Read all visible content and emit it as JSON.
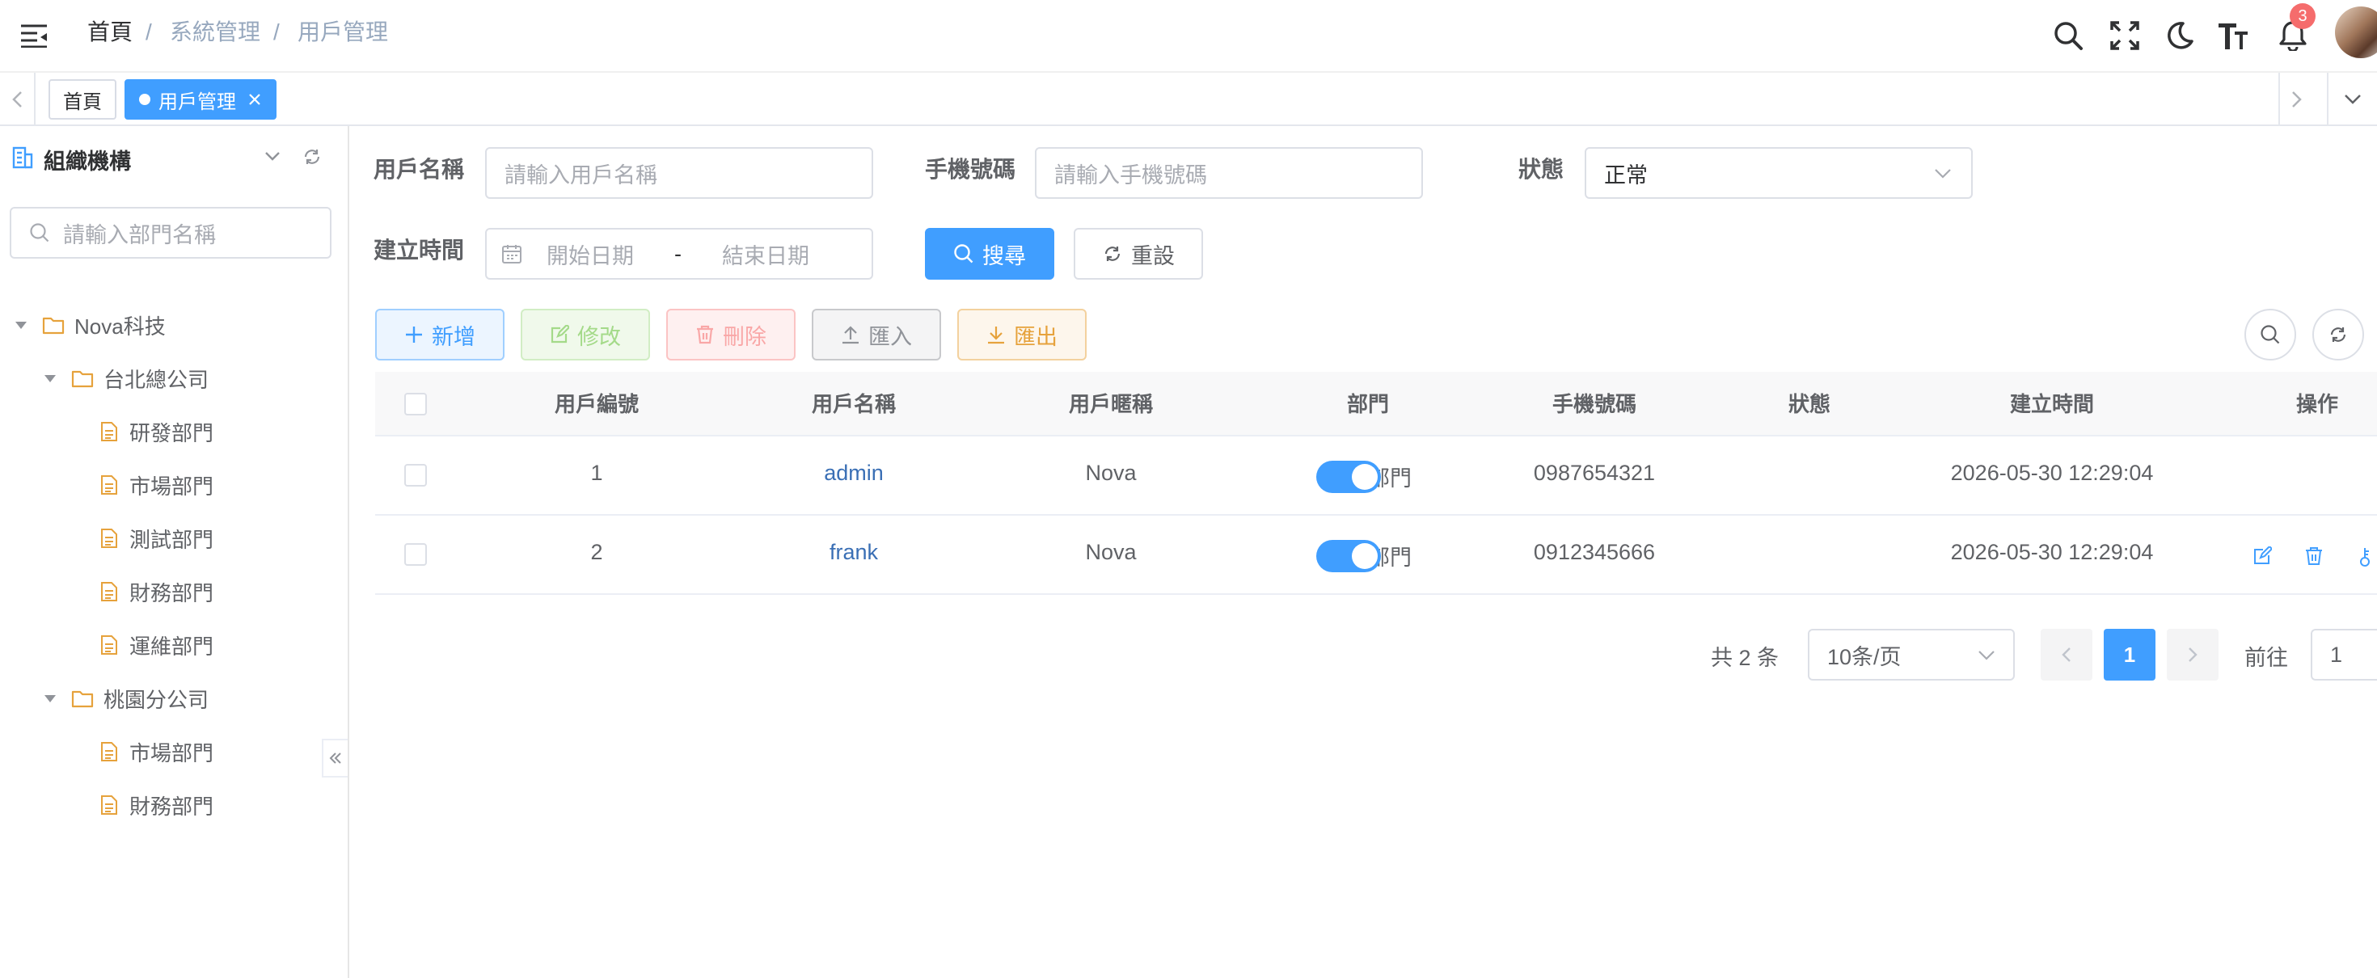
{
  "header": {
    "breadcrumb": [
      "首頁",
      "系統管理",
      "用戶管理"
    ],
    "separator": "/",
    "notification_count": "3"
  },
  "tabs": {
    "home": "首頁",
    "active": "用戶管理"
  },
  "sidebar": {
    "title": "組織機構",
    "search_placeholder": "請輸入部門名稱",
    "tree": {
      "root": "Nova科技",
      "branches": [
        {
          "label": "台北總公司",
          "children": [
            "研發部門",
            "市場部門",
            "測試部門",
            "財務部門",
            "運維部門"
          ]
        },
        {
          "label": "桃園分公司",
          "children": [
            "市場部門",
            "財務部門"
          ]
        }
      ]
    }
  },
  "filters": {
    "username_label": "用戶名稱",
    "username_placeholder": "請輸入用戶名稱",
    "phone_label": "手機號碼",
    "phone_placeholder": "請輸入手機號碼",
    "status_label": "狀態",
    "status_value": "正常",
    "created_label": "建立時間",
    "start_placeholder": "開始日期",
    "range_separator": "-",
    "end_placeholder": "結束日期",
    "search_button": "搜尋",
    "reset_button": "重設"
  },
  "toolbar": {
    "add": "新增",
    "edit": "修改",
    "delete": "刪除",
    "import": "匯入",
    "export": "匯出"
  },
  "table": {
    "columns": [
      "用戶編號",
      "用戶名稱",
      "用戶暱稱",
      "部門",
      "手機號碼",
      "狀態",
      "建立時間",
      "操作"
    ],
    "rows": [
      {
        "id": "1",
        "username": "admin",
        "nickname": "Nova",
        "dept": "研發部門",
        "phone": "0987654321",
        "status_on": true,
        "created": "2026-05-30 12:29:04"
      },
      {
        "id": "2",
        "username": "frank",
        "nickname": "Nova",
        "dept": "測試部門",
        "phone": "0912345666",
        "status_on": true,
        "created": "2026-05-30 12:29:04"
      }
    ]
  },
  "pagination": {
    "total": "共 2 条",
    "page_size": "10条/页",
    "current_page": "1",
    "goto_label": "前往",
    "goto_value": "1"
  },
  "colors": {
    "primary": "#409eff",
    "success": "#67c23a",
    "danger": "#f56c6c",
    "warning": "#e6a23c",
    "link": "#3a6fb5",
    "badge": "#f56c6c"
  }
}
